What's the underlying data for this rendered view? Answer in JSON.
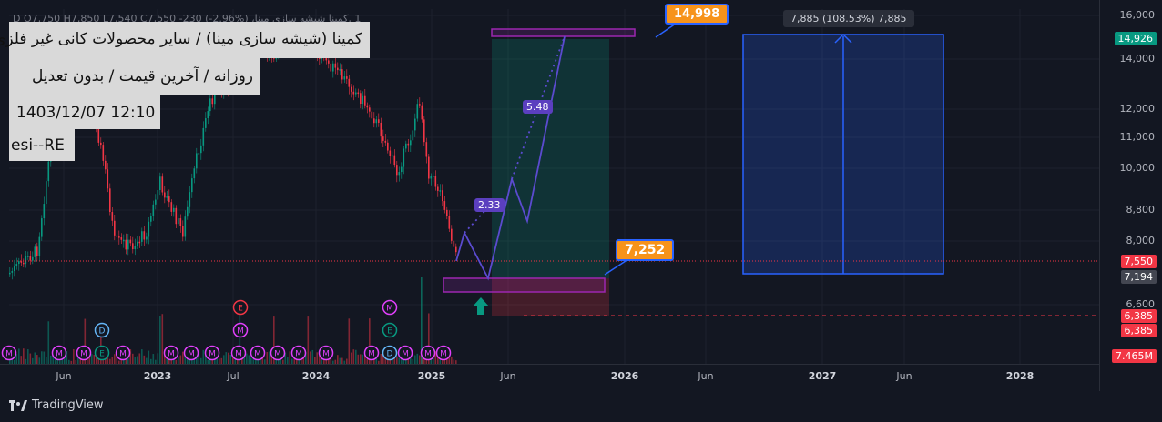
{
  "legend": "1 ,کمینا شیشه سازی مینا، D  O7,750  H7,850  L7,540  C7,550  -230 (-2.96%)",
  "info": {
    "title": "کمینا (شیشه سازی مینا) / سایر محصولات کانی غیر فلزی",
    "subtitle": "روزانه / آخرین قیمت / بدون تعدیل",
    "datetime": "1403/12/07 12:10",
    "author": "esi--RE"
  },
  "y_axis": {
    "ticks": [
      "16,000",
      "14,000",
      "12,000",
      "11,000",
      "10,000",
      "8,800",
      "8,000",
      "6,600"
    ],
    "badges": [
      {
        "text": "14,926",
        "color": "#089981"
      },
      {
        "text": "7,550",
        "color": "#f23645"
      },
      {
        "text": "7,194",
        "color": "#434651"
      },
      {
        "text": "6,385",
        "color": "#f23645"
      },
      {
        "text": "6,385",
        "color": "#f23645"
      },
      {
        "text": "7.465M",
        "color": "#f23645"
      }
    ]
  },
  "x_axis": {
    "ticks": [
      "Jun",
      "2023",
      "Jul",
      "2024",
      "2025",
      "Jun",
      "2026",
      "Jun",
      "2027",
      "Jun",
      "2028"
    ]
  },
  "callouts": {
    "target": "14,998",
    "entry": "7,252"
  },
  "measure_tooltip": "7,885 (108.53%) 7,885",
  "wave_labels": {
    "first": "2.33",
    "second": "5.48"
  },
  "markers": [
    "D",
    "E",
    "M",
    "E",
    "D"
  ],
  "brand": {
    "name": "TradingView"
  },
  "colors": {
    "up": "#089981",
    "down": "#f23645",
    "accent": "#2962ff",
    "purple": "#9c27b0"
  }
}
